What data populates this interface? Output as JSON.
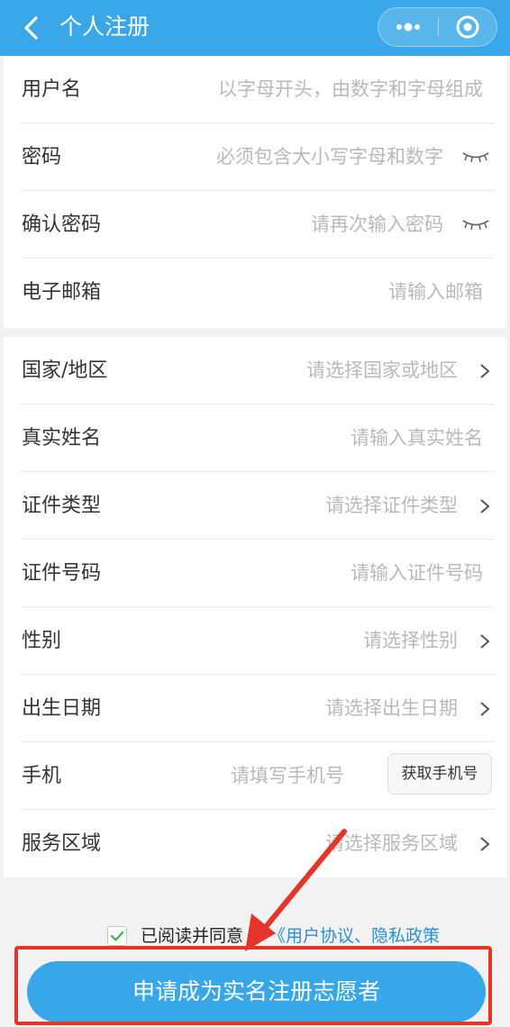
{
  "nav": {
    "title": "个人注册"
  },
  "form": {
    "username": {
      "label": "用户名",
      "placeholder": "以字母开头，由数字和字母组成"
    },
    "password": {
      "label": "密码",
      "placeholder": "必须包含大小写字母和数字"
    },
    "confirm_password": {
      "label": "确认密码",
      "placeholder": "请再次输入密码"
    },
    "email": {
      "label": "电子邮箱",
      "placeholder": "请输入邮箱"
    },
    "country": {
      "label": "国家/地区",
      "placeholder": "请选择国家或地区"
    },
    "real_name": {
      "label": "真实姓名",
      "placeholder": "请输入真实姓名"
    },
    "id_type": {
      "label": "证件类型",
      "placeholder": "请选择证件类型"
    },
    "id_number": {
      "label": "证件号码",
      "placeholder": "请输入证件号码"
    },
    "gender": {
      "label": "性别",
      "placeholder": "请选择性别"
    },
    "birth_date": {
      "label": "出生日期",
      "placeholder": "请选择出生日期"
    },
    "phone": {
      "label": "手机",
      "placeholder": "请填写手机号",
      "button_label": "获取手机号"
    },
    "service_area": {
      "label": "服务区域",
      "placeholder": "请选择服务区域"
    }
  },
  "agreement": {
    "checked": true,
    "text": "已阅读并同意",
    "links": "《用户协议、隐私政策"
  },
  "submit": {
    "label": "申请成为实名注册志愿者"
  },
  "colors": {
    "nav": "#3aa8e8",
    "primary_button": "#37a7ea",
    "link": "#2e8fd6",
    "highlight": "#e5352b",
    "checkmark": "#3bb34a"
  },
  "icons": [
    "back-arrow-icon",
    "more-dots-icon",
    "close-circle-icon",
    "eye-closed-icon",
    "chevron-right-icon",
    "checkmark-icon",
    "annotation-arrow"
  ]
}
